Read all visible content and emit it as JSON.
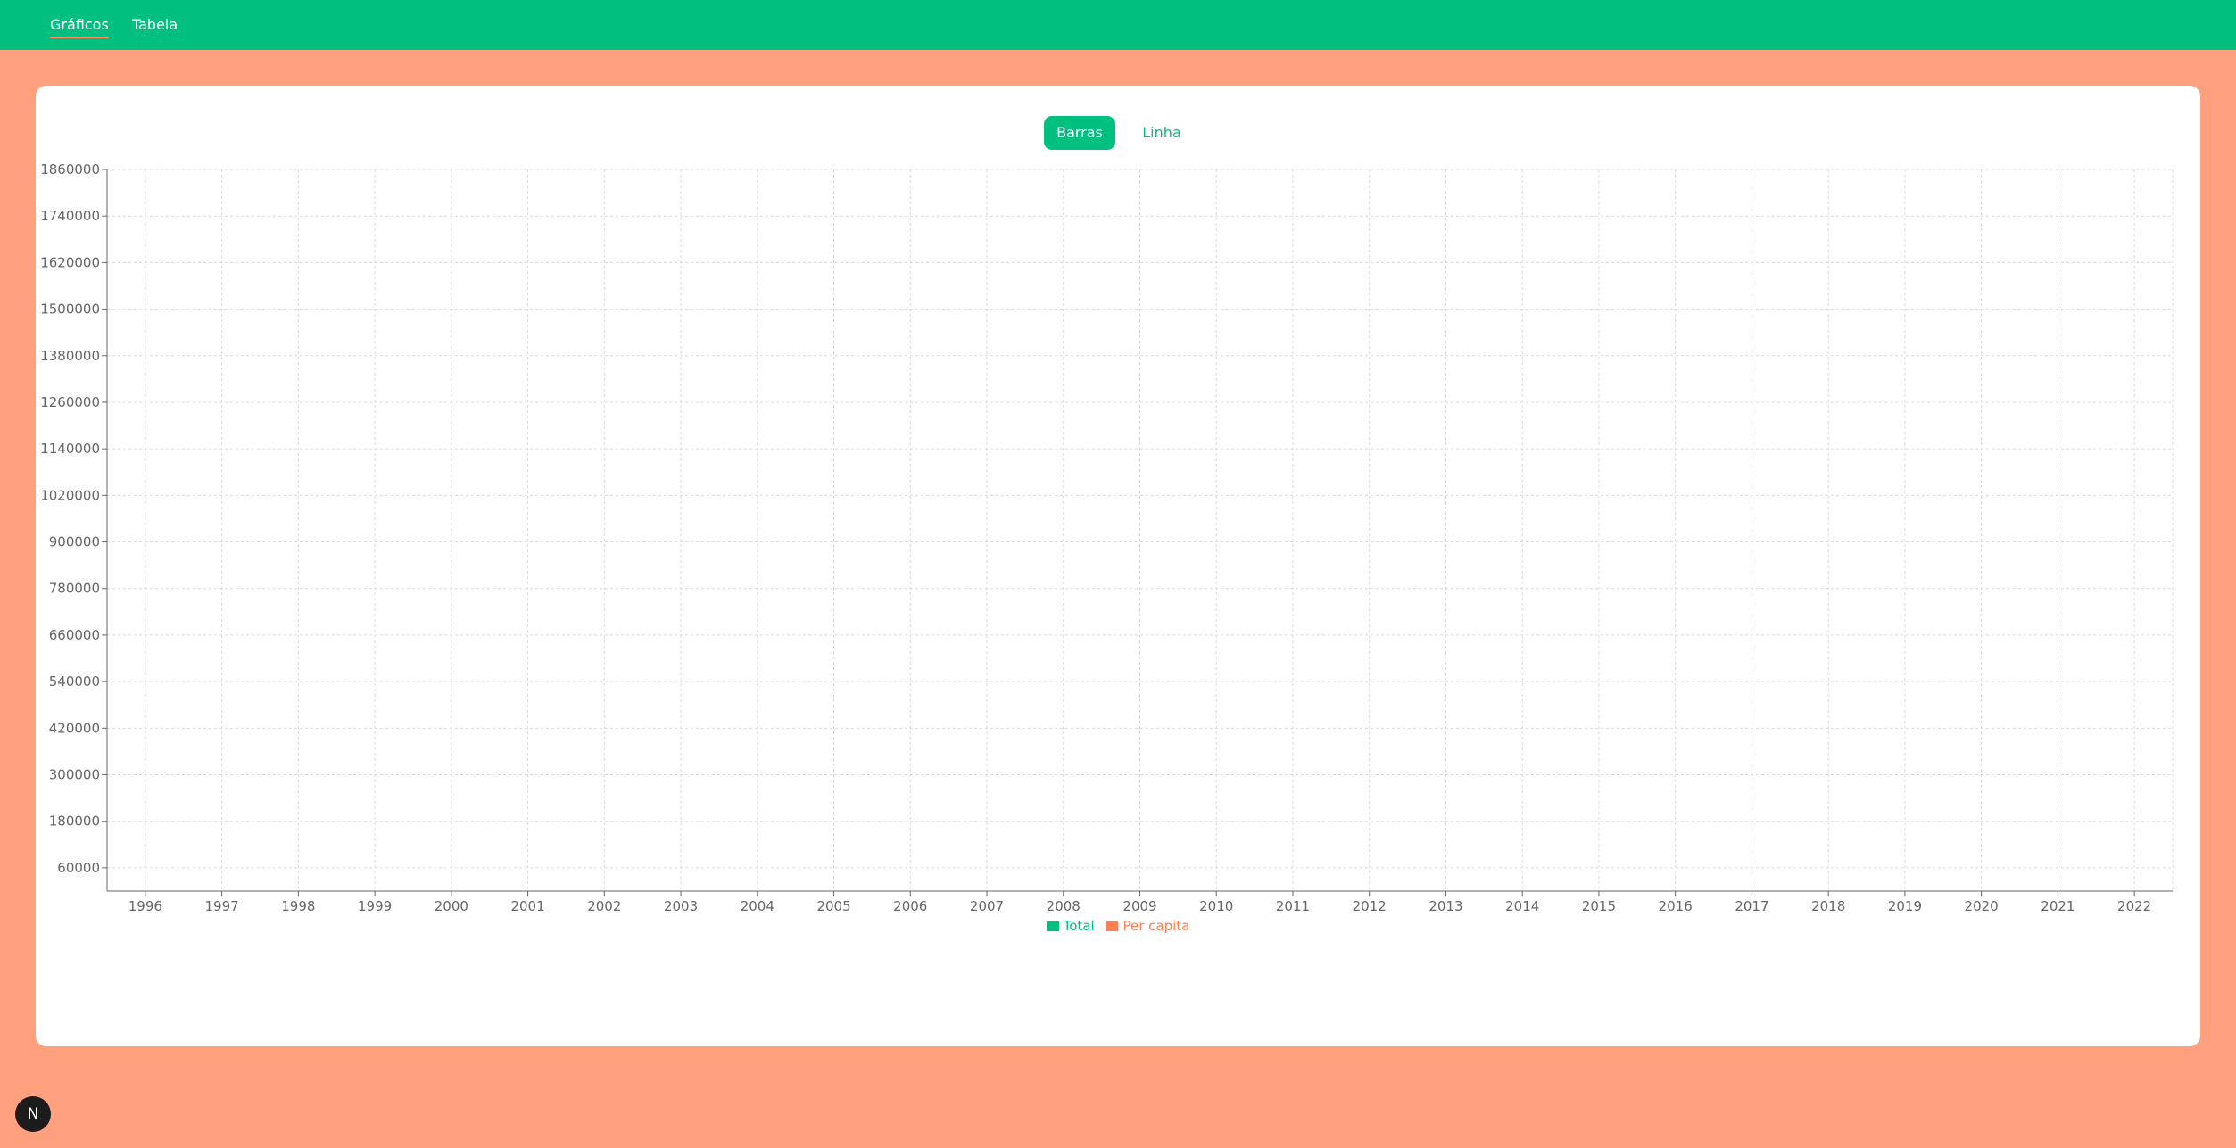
{
  "nav": {
    "items": [
      {
        "label": "Gráficos",
        "active": true
      },
      {
        "label": "Tabela",
        "active": false
      }
    ]
  },
  "toggle": {
    "options": [
      {
        "label": "Barras",
        "active": true
      },
      {
        "label": "Linha",
        "active": false
      }
    ]
  },
  "chart_data": {
    "type": "bar",
    "categories": [
      "1996",
      "1997",
      "1998",
      "1999",
      "2000",
      "2001",
      "2002",
      "2003",
      "2004",
      "2005",
      "2006",
      "2007",
      "2008",
      "2009",
      "2010",
      "2011",
      "2012",
      "2013",
      "2014",
      "2015",
      "2016",
      "2017",
      "2018",
      "2019",
      "2020",
      "2021",
      "2022"
    ],
    "yticks": [
      60000,
      180000,
      300000,
      420000,
      540000,
      660000,
      780000,
      900000,
      1020000,
      1140000,
      1260000,
      1380000,
      1500000,
      1620000,
      1740000,
      1860000
    ],
    "ylim": [
      0,
      1860000
    ],
    "grid": true,
    "series": [
      {
        "name": "Total",
        "color": "#00BF7F",
        "values": []
      },
      {
        "name": "Per capita",
        "color": "#FF7F50",
        "values": []
      }
    ],
    "legend_position": "bottom-center"
  },
  "colors": {
    "accent": "#00BF7F",
    "background": "#FFA07F",
    "secondary": "#FF7F50"
  },
  "badge": {
    "label": "N",
    "icon": "nextjs-icon"
  }
}
